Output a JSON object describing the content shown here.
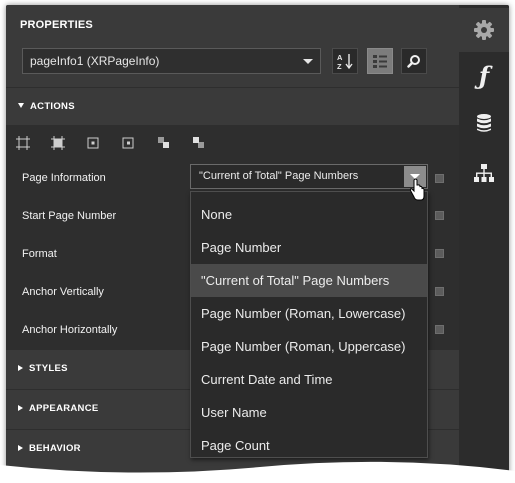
{
  "panel": {
    "title": "PROPERTIES",
    "object_selector": "pageInfo1 (XRPageInfo)"
  },
  "toolbar": {
    "buttons": [
      {
        "icon": "sort-alphabetical-icon",
        "active": false
      },
      {
        "icon": "categorized-view-icon",
        "active": true
      },
      {
        "icon": "search-icon",
        "active": false
      }
    ]
  },
  "sections": {
    "actions": "ACTIONS",
    "styles": "STYLES",
    "appearance": "APPEARANCE",
    "behavior": "BEHAVIOR"
  },
  "action_icons": [
    "fit-bounds-icon",
    "fit-text-icon",
    "align-center-icon",
    "align-right-icon",
    "bring-forward-icon",
    "send-backward-icon"
  ],
  "properties": {
    "page_information": "Page Information",
    "page_information_value": "\"Current of Total\" Page Numbers",
    "start_page_number": "Start Page Number",
    "format": "Format",
    "anchor_vertically": "Anchor Vertically",
    "anchor_horizontally": "Anchor Horizontally"
  },
  "dropdown": {
    "options": [
      "None",
      "Page Number",
      "\"Current of Total\" Page Numbers",
      "Page Number (Roman, Lowercase)",
      "Page Number (Roman, Uppercase)",
      "Current Date and Time",
      "User Name",
      "Page Count"
    ],
    "selected_index": 2
  },
  "side_tabs": [
    "gear-icon",
    "function-icon",
    "database-icon",
    "hierarchy-icon"
  ],
  "colors": {
    "panel_bg": "#3a3a3a",
    "body_bg": "#2e2e2e",
    "sidebar_bg": "#2c2c2c",
    "selected_item": "#4a4a4a",
    "active_button": "#7c7c7c"
  }
}
